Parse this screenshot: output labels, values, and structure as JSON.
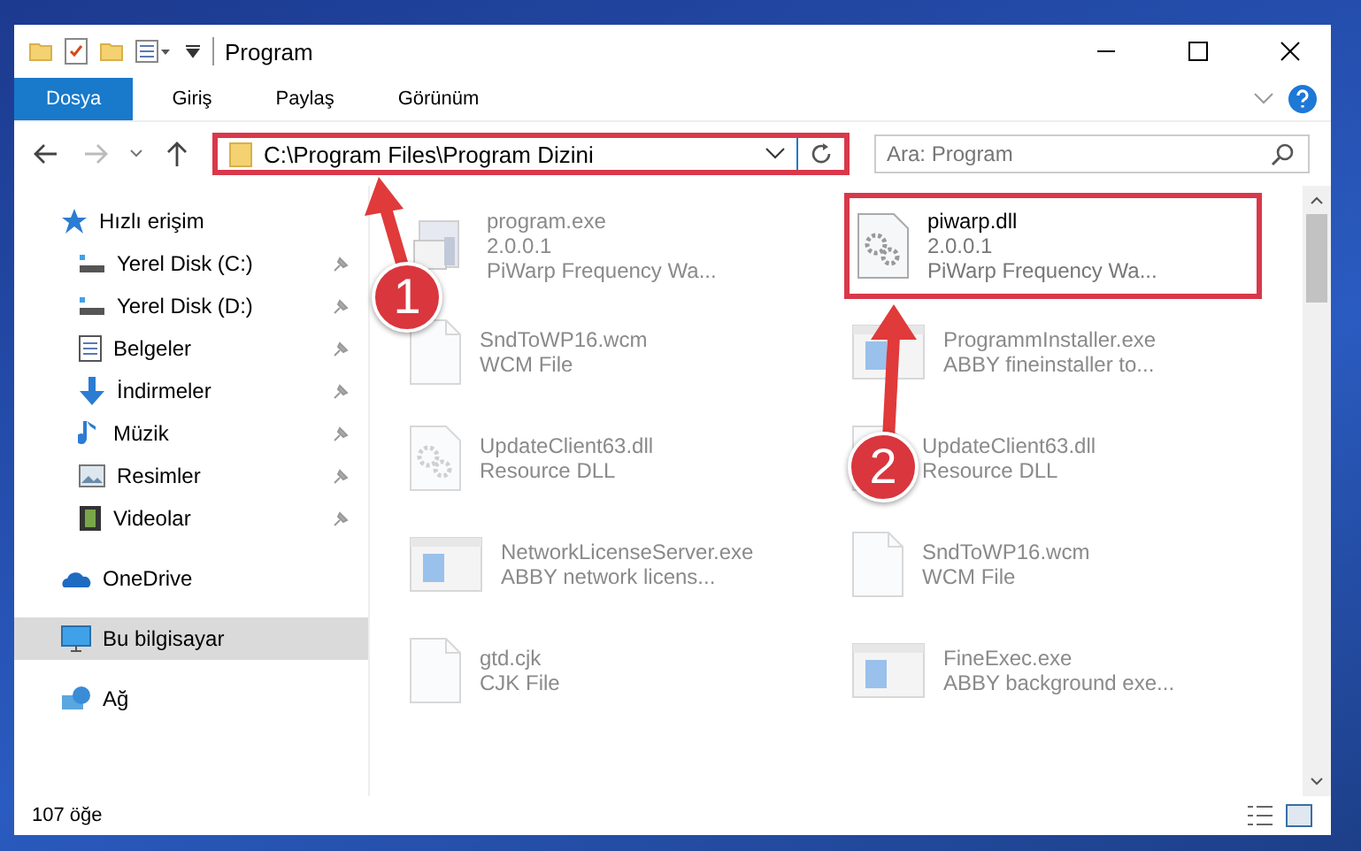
{
  "window": {
    "title": "Program"
  },
  "ribbon": {
    "tabs": [
      {
        "label": "Dosya",
        "selected": true
      },
      {
        "label": "Giriş",
        "selected": false
      },
      {
        "label": "Paylaş",
        "selected": false
      },
      {
        "label": "Görünüm",
        "selected": false
      }
    ]
  },
  "address_bar": {
    "path": "C:\\Program Files\\Program Dizini",
    "annotated": true
  },
  "search": {
    "placeholder": "Ara: Program"
  },
  "sidebar": {
    "items": [
      {
        "label": "Hızlı erişim",
        "kind": "star",
        "selected": false,
        "children": [
          {
            "label": "Yerel Disk (C:)",
            "kind": "drive",
            "pinned": true
          },
          {
            "label": "Yerel Disk (D:)",
            "kind": "drive",
            "pinned": true
          },
          {
            "label": "Belgeler",
            "kind": "doc",
            "pinned": true
          },
          {
            "label": "İndirmeler",
            "kind": "download",
            "pinned": true
          },
          {
            "label": "Müzik",
            "kind": "music",
            "pinned": true
          },
          {
            "label": "Resimler",
            "kind": "image",
            "pinned": true
          },
          {
            "label": "Videolar",
            "kind": "video",
            "pinned": true
          }
        ]
      },
      {
        "label": "OneDrive",
        "kind": "cloud",
        "selected": false
      },
      {
        "label": "Bu bilgisayar",
        "kind": "pc",
        "selected": true
      },
      {
        "label": "Ağ",
        "kind": "network",
        "selected": false
      }
    ]
  },
  "files": [
    {
      "name": "program.exe",
      "lines": [
        "2.0.0.1",
        "PiWarp Frequency Wa..."
      ],
      "kind": "app",
      "dimmed": true,
      "annotated": false
    },
    {
      "name": "piwarp.dll",
      "lines": [
        "2.0.0.1",
        "PiWarp Frequency Wa..."
      ],
      "kind": "dll",
      "dimmed": false,
      "annotated": true
    },
    {
      "name": "SndToWP16.wcm",
      "lines": [
        "WCM File"
      ],
      "kind": "doc",
      "dimmed": true,
      "annotated": false
    },
    {
      "name": "ProgrammInstaller.exe",
      "lines": [
        "ABBY fineinstaller to..."
      ],
      "kind": "window",
      "dimmed": true,
      "annotated": false
    },
    {
      "name": "UpdateClient63.dll",
      "lines": [
        "Resource DLL"
      ],
      "kind": "dll",
      "dimmed": true,
      "annotated": false
    },
    {
      "name": "UpdateClient63.dll",
      "lines": [
        "Resource DLL"
      ],
      "kind": "dll",
      "dimmed": true,
      "annotated": false
    },
    {
      "name": "NetworkLicenseServer.exe",
      "lines": [
        "ABBY network licens..."
      ],
      "kind": "window",
      "dimmed": true,
      "annotated": false
    },
    {
      "name": "SndToWP16.wcm",
      "lines": [
        "WCM File"
      ],
      "kind": "doc",
      "dimmed": true,
      "annotated": false
    },
    {
      "name": "gtd.cjk",
      "lines": [
        "CJK File"
      ],
      "kind": "doc",
      "dimmed": true,
      "annotated": false
    },
    {
      "name": "FineExec.exe",
      "lines": [
        "ABBY background exe..."
      ],
      "kind": "window",
      "dimmed": true,
      "annotated": false
    }
  ],
  "status_bar": {
    "count": "107 öğe"
  },
  "annotations": [
    {
      "number": "1"
    },
    {
      "number": "2"
    }
  ]
}
